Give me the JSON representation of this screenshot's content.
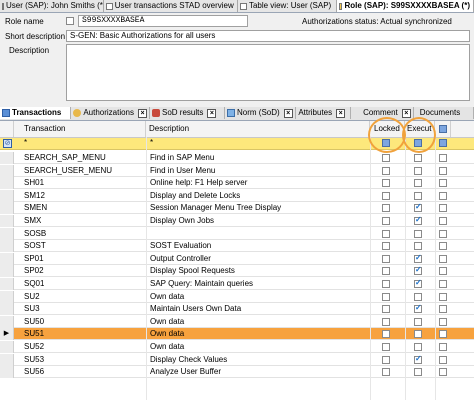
{
  "tabs": [
    {
      "label": "User (SAP): John Smiths (*)",
      "active": false
    },
    {
      "label": "User transactions STAD overview",
      "active": false
    },
    {
      "label": "Table view: User (SAP)",
      "active": false
    },
    {
      "label": "Role (SAP): S99SXXXXBASEA (*)",
      "active": true
    }
  ],
  "form": {
    "role_name_label": "Role name",
    "role_name_value": "S99SXXXXBASEA",
    "auth_status": "Authorizations status: Actual synchronized",
    "short_desc_label": "Short description",
    "short_desc_value": "S-GEN: Basic Authorizations for all users",
    "description_label": "Description",
    "description_value": ""
  },
  "subtabs": [
    {
      "label": "Transactions",
      "active": true
    },
    {
      "label": "Authorizations",
      "active": false
    },
    {
      "label": "SoD results",
      "active": false
    },
    {
      "label": "Norm (SoD)",
      "active": false
    },
    {
      "label": "Attributes",
      "active": false
    },
    {
      "label": "Comment",
      "active": false
    },
    {
      "label": "Documents",
      "active": false
    }
  ],
  "grid": {
    "col_transaction": "Transaction",
    "col_description": "Description",
    "col_locked": "Locked",
    "col_execut": "Execut",
    "filter_transaction": "*",
    "filter_description": "*",
    "rows": [
      {
        "t": "SEARCH_SAP_MENU",
        "d": "Find in SAP Menu",
        "locked": false,
        "execut": false,
        "selected": false
      },
      {
        "t": "SEARCH_USER_MENU",
        "d": "Find in User Menu",
        "locked": false,
        "execut": false,
        "selected": false
      },
      {
        "t": "SH01",
        "d": "Online help: F1 Help server",
        "locked": false,
        "execut": false,
        "selected": false
      },
      {
        "t": "SM12",
        "d": "Display and Delete Locks",
        "locked": false,
        "execut": false,
        "selected": false
      },
      {
        "t": "SMEN",
        "d": "Session Manager Menu Tree Display",
        "locked": false,
        "execut": true,
        "selected": false
      },
      {
        "t": "SMX",
        "d": "Display Own Jobs",
        "locked": false,
        "execut": true,
        "selected": false
      },
      {
        "t": "SOSB",
        "d": "",
        "locked": false,
        "execut": false,
        "selected": false
      },
      {
        "t": "SOST",
        "d": "SOST Evaluation",
        "locked": false,
        "execut": false,
        "selected": false
      },
      {
        "t": "SP01",
        "d": "Output Controller",
        "locked": false,
        "execut": true,
        "selected": false
      },
      {
        "t": "SP02",
        "d": "Display Spool Requests",
        "locked": false,
        "execut": true,
        "selected": false
      },
      {
        "t": "SQ01",
        "d": "SAP Query: Maintain queries",
        "locked": false,
        "execut": true,
        "selected": false
      },
      {
        "t": "SU2",
        "d": "Own data",
        "locked": false,
        "execut": false,
        "selected": false
      },
      {
        "t": "SU3",
        "d": "Maintain Users Own Data",
        "locked": false,
        "execut": true,
        "selected": false
      },
      {
        "t": "SU50",
        "d": "Own data",
        "locked": false,
        "execut": false,
        "selected": false
      },
      {
        "t": "SU51",
        "d": "Own data",
        "locked": false,
        "execut": false,
        "selected": true
      },
      {
        "t": "SU52",
        "d": "Own data",
        "locked": false,
        "execut": false,
        "selected": false
      },
      {
        "t": "SU53",
        "d": "Display Check Values",
        "locked": false,
        "execut": true,
        "selected": false
      },
      {
        "t": "SU56",
        "d": "Analyze User Buffer",
        "locked": false,
        "execut": false,
        "selected": false
      }
    ]
  },
  "colors": {
    "selected_row": "#f7a23e",
    "filter_row": "#fde87c",
    "highlight_circle": "#f0a23c"
  }
}
